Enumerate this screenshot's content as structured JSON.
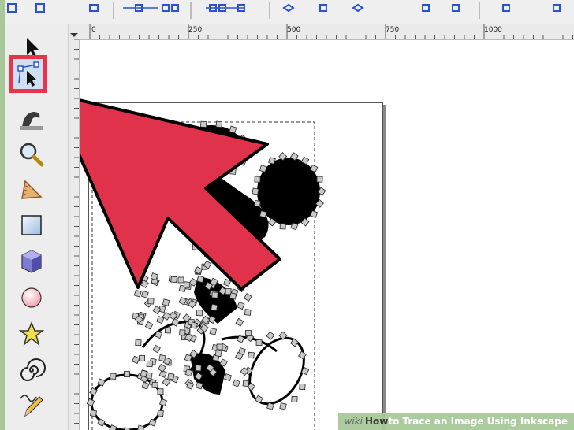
{
  "ruler": {
    "ticks": [
      "0",
      "250",
      "500",
      "750",
      "1000"
    ]
  },
  "tools": [
    {
      "name": "selector-tool"
    },
    {
      "name": "node-tool",
      "active": true
    },
    {
      "name": "tweak-tool"
    },
    {
      "name": "zoom-tool"
    },
    {
      "name": "measure-tool"
    },
    {
      "name": "rectangle-tool"
    },
    {
      "name": "3d-box-tool"
    },
    {
      "name": "ellipse-tool"
    },
    {
      "name": "star-tool"
    },
    {
      "name": "spiral-tool"
    },
    {
      "name": "pencil-tool"
    }
  ],
  "watermark": {
    "wiki": "wiki",
    "how": "How",
    "title": " to Trace an Image Using Inkscape"
  },
  "colors": {
    "highlight": "#e8334a",
    "arrow": "#e0324a",
    "background": "#a8c89a"
  }
}
